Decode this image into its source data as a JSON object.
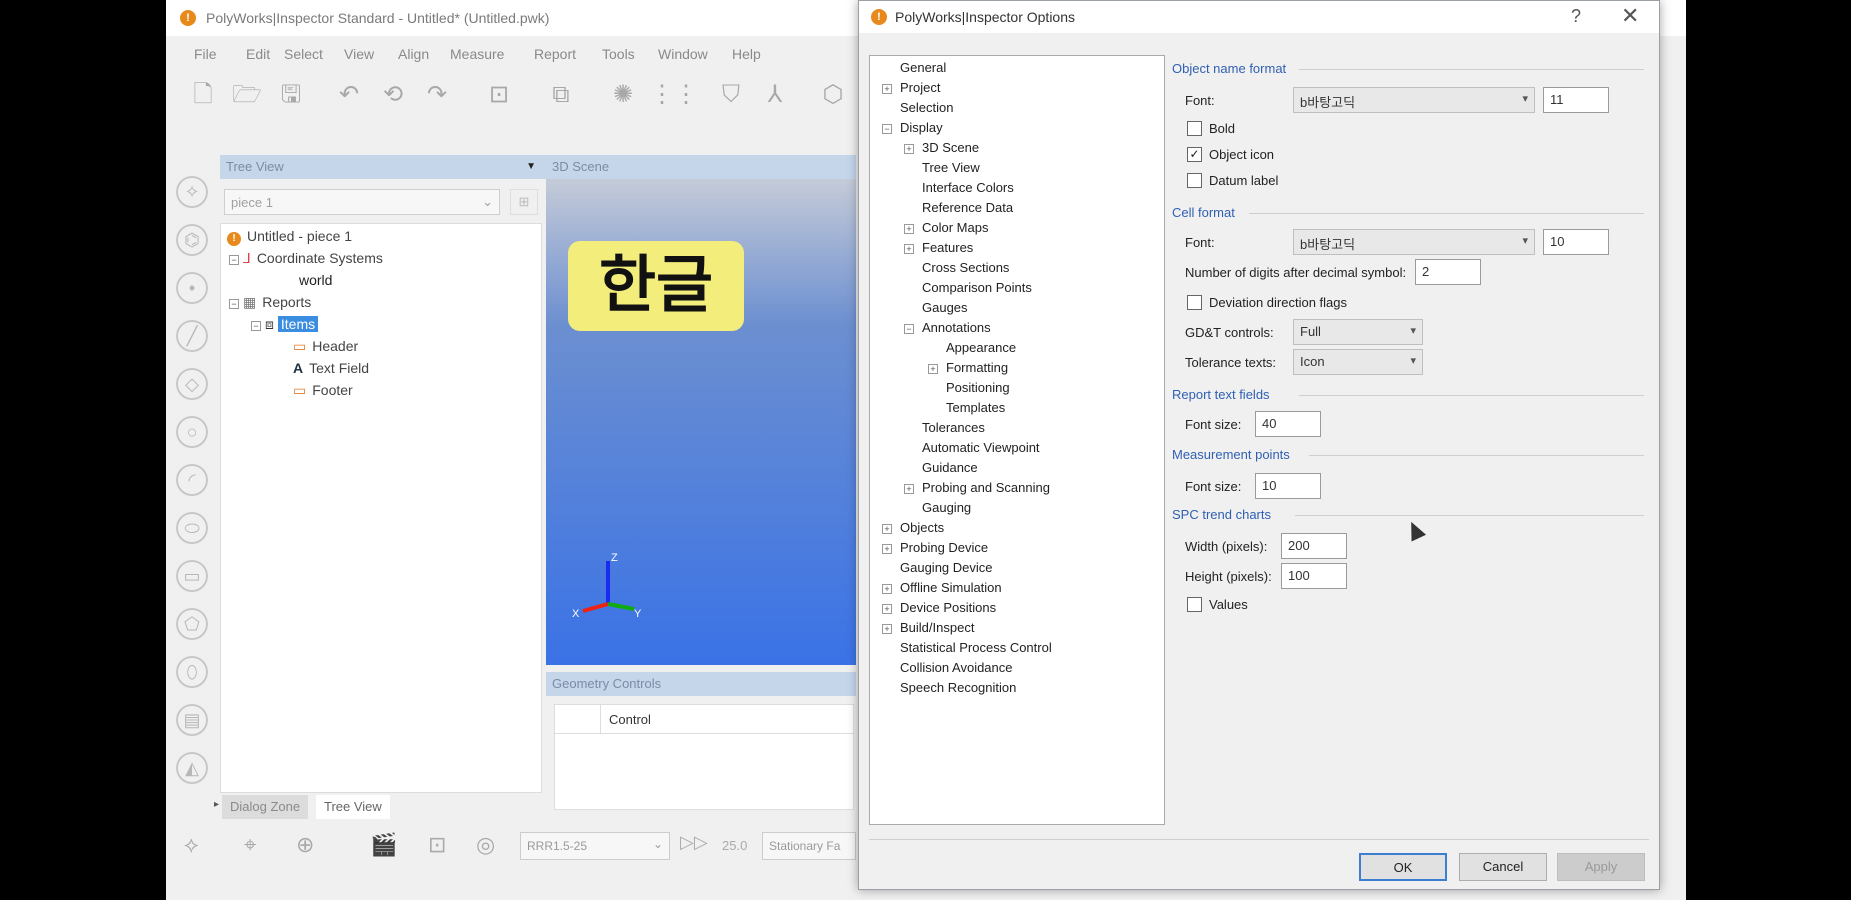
{
  "main_window": {
    "title": "PolyWorks|Inspector Standard - Untitled* (Untitled.pwk)",
    "menu": [
      "File",
      "Edit",
      "Select",
      "View",
      "Align",
      "Measure",
      "Report",
      "Tools",
      "Window",
      "Help"
    ]
  },
  "tree_view": {
    "header": "Tree View",
    "combo_value": "piece 1",
    "nodes": {
      "root": "Untitled - piece 1",
      "coord_systems": "Coordinate Systems",
      "world": "world",
      "reports": "Reports",
      "items": "Items",
      "header": "Header",
      "text_field": "Text Field",
      "footer": "Footer"
    },
    "tabs": [
      "Dialog Zone",
      "Tree View"
    ]
  },
  "scene": {
    "header": "3D Scene",
    "overlay_text": "한글",
    "axis_z": "Z",
    "axis_x": "X",
    "axis_y": "Y"
  },
  "geometry_controls": {
    "header": "Geometry Controls",
    "column": "Control"
  },
  "bottom_toolbar": {
    "combo_value": "RRR1.5-25",
    "zoom": "25.0",
    "stationary": "Stationary Fa"
  },
  "dialog": {
    "title": "PolyWorks|Inspector Options",
    "help_glyph": "?",
    "close_glyph": "✕",
    "categories": {
      "general": "General",
      "project": "Project",
      "selection": "Selection",
      "display": "Display",
      "scene3d": "3D Scene",
      "tree_view": "Tree View",
      "interface_colors": "Interface Colors",
      "reference_data": "Reference Data",
      "color_maps": "Color Maps",
      "features": "Features",
      "cross_sections": "Cross Sections",
      "comparison_points": "Comparison Points",
      "gauges": "Gauges",
      "annotations": "Annotations",
      "appearance": "Appearance",
      "formatting": "Formatting",
      "positioning": "Positioning",
      "templates": "Templates",
      "tolerances": "Tolerances",
      "automatic_viewpoint": "Automatic Viewpoint",
      "guidance": "Guidance",
      "probing_scanning": "Probing and Scanning",
      "gauging": "Gauging",
      "objects": "Objects",
      "probing_device": "Probing Device",
      "gauging_device": "Gauging Device",
      "offline_simulation": "Offline Simulation",
      "device_positions": "Device Positions",
      "build_inspect": "Build/Inspect",
      "spc": "Statistical Process Control",
      "collision": "Collision Avoidance",
      "speech": "Speech Recognition"
    },
    "object_name_format": {
      "title": "Object name format",
      "font_label": "Font:",
      "font_value": "b바탕고딕",
      "size_value": "11",
      "bold": "Bold",
      "object_icon": "Object icon",
      "datum_label": "Datum label",
      "bold_checked": false,
      "object_icon_checked": true,
      "datum_label_checked": false
    },
    "cell_format": {
      "title": "Cell format",
      "font_label": "Font:",
      "font_value": "b바탕고딕",
      "size_value": "10",
      "digits_label": "Number of digits after decimal symbol:",
      "digits_value": "2",
      "deviation_flags": "Deviation direction flags",
      "deviation_checked": false,
      "gdt_label": "GD&T controls:",
      "gdt_value": "Full",
      "tolerance_label": "Tolerance texts:",
      "tolerance_value": "Icon"
    },
    "report_text_fields": {
      "title": "Report text fields",
      "font_size_label": "Font size:",
      "font_size_value": "40"
    },
    "measurement_points": {
      "title": "Measurement points",
      "font_size_label": "Font size:",
      "font_size_value": "10"
    },
    "spc_trend_charts": {
      "title": "SPC trend charts",
      "width_label": "Width (pixels):",
      "width_value": "200",
      "height_label": "Height (pixels):",
      "height_value": "100",
      "values_label": "Values",
      "values_checked": false
    },
    "buttons": {
      "ok": "OK",
      "cancel": "Cancel",
      "apply": "Apply"
    }
  }
}
